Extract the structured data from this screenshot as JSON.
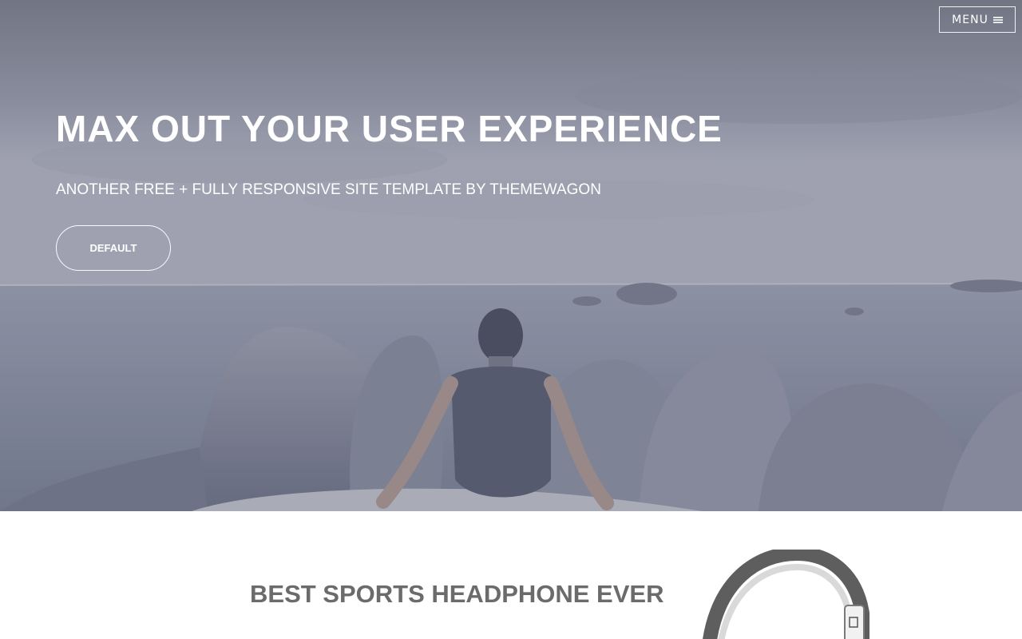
{
  "nav": {
    "menu_label": "MENU",
    "menu_icon": "hamburger-icon"
  },
  "hero": {
    "title": "MAX OUT YOUR USER EXPERIENCE",
    "subtitle": "ANOTHER FREE + FULLY RESPONSIVE SITE TEMPLATE BY THEMEWAGON",
    "button_label": "DEFAULT",
    "background_image": "man-sitting-on-rocks-by-sea-photo"
  },
  "product": {
    "title": "BEST SPORTS HEADPHONE EVER",
    "image": "sports-headphone-photo"
  },
  "colors": {
    "overlay": "#7d8296",
    "text_light": "#ffffff",
    "heading_gray": "#6b6b6b"
  }
}
